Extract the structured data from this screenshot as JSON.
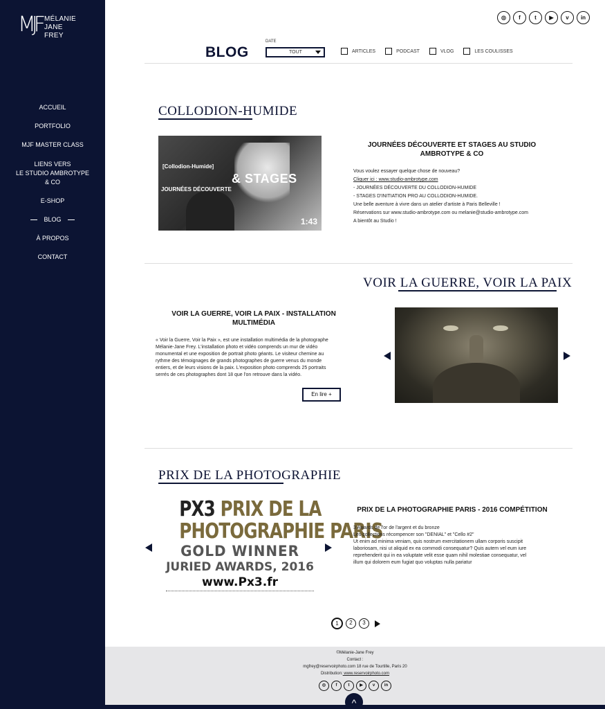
{
  "brand": {
    "logo_mark": "MJF",
    "name_lines": [
      "MÉLANIE",
      "JANE",
      "FREY"
    ]
  },
  "colors": {
    "navy": "#0c1433",
    "footer_bg": "#e6e6e8"
  },
  "nav": {
    "items": [
      {
        "label": "ACCUEIL"
      },
      {
        "label": "PORTFOLIO"
      },
      {
        "label": "MJF MASTER CLASS"
      },
      {
        "label": "LIENS VERS\nLE STUDIO AMBROTYPE\n& CO"
      },
      {
        "label": "E-SHOP"
      },
      {
        "label": "BLOG",
        "active": true
      },
      {
        "label": "À PROPOS"
      },
      {
        "label": "CONTACT"
      }
    ]
  },
  "social": {
    "icons": [
      {
        "name": "instagram-icon",
        "glyph": "◎"
      },
      {
        "name": "facebook-icon",
        "glyph": "f"
      },
      {
        "name": "twitter-icon",
        "glyph": "t"
      },
      {
        "name": "youtube-icon",
        "glyph": "▶"
      },
      {
        "name": "vimeo-icon",
        "glyph": "v"
      },
      {
        "name": "linkedin-icon",
        "glyph": "in"
      }
    ]
  },
  "header": {
    "title": "BLOG",
    "date_label": "DATE",
    "date_value": "TOUT",
    "filters": [
      "ARTICLES",
      "PODCAST",
      "VLOG",
      "LES COULISSES"
    ]
  },
  "posts": [
    {
      "section_title": "COLLODION-HUMIDE",
      "heading": "JOURNÉES DÉCOUVERTE ET STAGES AU STUDIO AMBROTYPE & CO",
      "thumb_text": {
        "tag": "[Collodion-Humide]",
        "big": "& STAGES",
        "sub": "JOURNÉES DÉCOUVERTE",
        "duration": "1:43"
      },
      "body_lines": [
        "Vous voulez essayer quelque chose de nouveau?",
        "Cliquer ici : www.studio-ambrotype.com",
        "- JOURNÉES DÉCOUVERTE DU COLLODION-HUMIDE",
        "- STAGES D'INITIATION PRO AU COLLODION-HUMIDE.",
        "Une belle aventure à vivre dans un atelier d'artiste à Paris Belleville !",
        "Réservations sur www.studio-ambrotype.com ou melanie@studio-ambrotype.com",
        "A bientôt au Studio !"
      ]
    },
    {
      "section_title": "VOIR LA GUERRE, VOIR LA PAIX",
      "heading": "VOIR LA GUERRE, VOIR LA PAIX - INSTALLATION MULTIMÉDIA",
      "body_lines": [
        "« Voir la Guerre, Voir la Paix », est une installation multimédia de la photographe",
        "Mélanie-Jane Frey. L'installation photo et vidéo comprends un mur de vidéo",
        "monumental et une exposition de portrait photo géants. Le visiteur chemine au",
        "rythme des témoignages de grands photographes de guerre venus du monde",
        "entiers, et de leurs visions de la paix. L'exposition photo comprends 25 portraits",
        "serrés de ces photographes dont 18 que l'on retrouve dans la vidéo."
      ],
      "more_label": "En lire +"
    },
    {
      "section_title": "PRIX DE LA PHOTOGRAPHIE",
      "heading": "PRIX DE LA PHOTOGRAPHIE PARIS - 2016 COMPÉTITION",
      "badge": {
        "line1_a": "PX3",
        "line1_b": "PRIX DE LA",
        "line2": "PHOTOGRAPHIE PARIS",
        "line3": "GOLD WINNER",
        "line4": "JURIED AWARDS, 2016",
        "line5": "www.Px3.fr"
      },
      "body_lines": [
        "3 Awards de l'or de l'argent et du bronze",
        "Les collections récompencer son \"DENIAL\" et \"Cello #2\"",
        "Ut enim ad minima veniam, quis nostrum exercitationem ullam corporis suscipit",
        "laboriosam, nisi ut aliquid ex ea commodi consequatur? Quis autem vel eum iure",
        "reprehenderit qui in ea voluptate velit esse quam nihil molestiae consequatur, vel",
        "illum qui dolorem eum fugiat quo voluptas nulla pariatur"
      ]
    }
  ],
  "pagination": {
    "pages": [
      "1",
      "2",
      "3"
    ],
    "current": "1"
  },
  "footer": {
    "copyright": "©Mélanie-Jane Frey",
    "contact_label": "Contact :",
    "contact_line": "mgfrey@reservoirphoto.com 18 rue de Tourtille, Paris 20",
    "distribution_label": "Distribution:",
    "distribution_link": " www.reservoirphoto.com",
    "up_glyph": "^"
  }
}
